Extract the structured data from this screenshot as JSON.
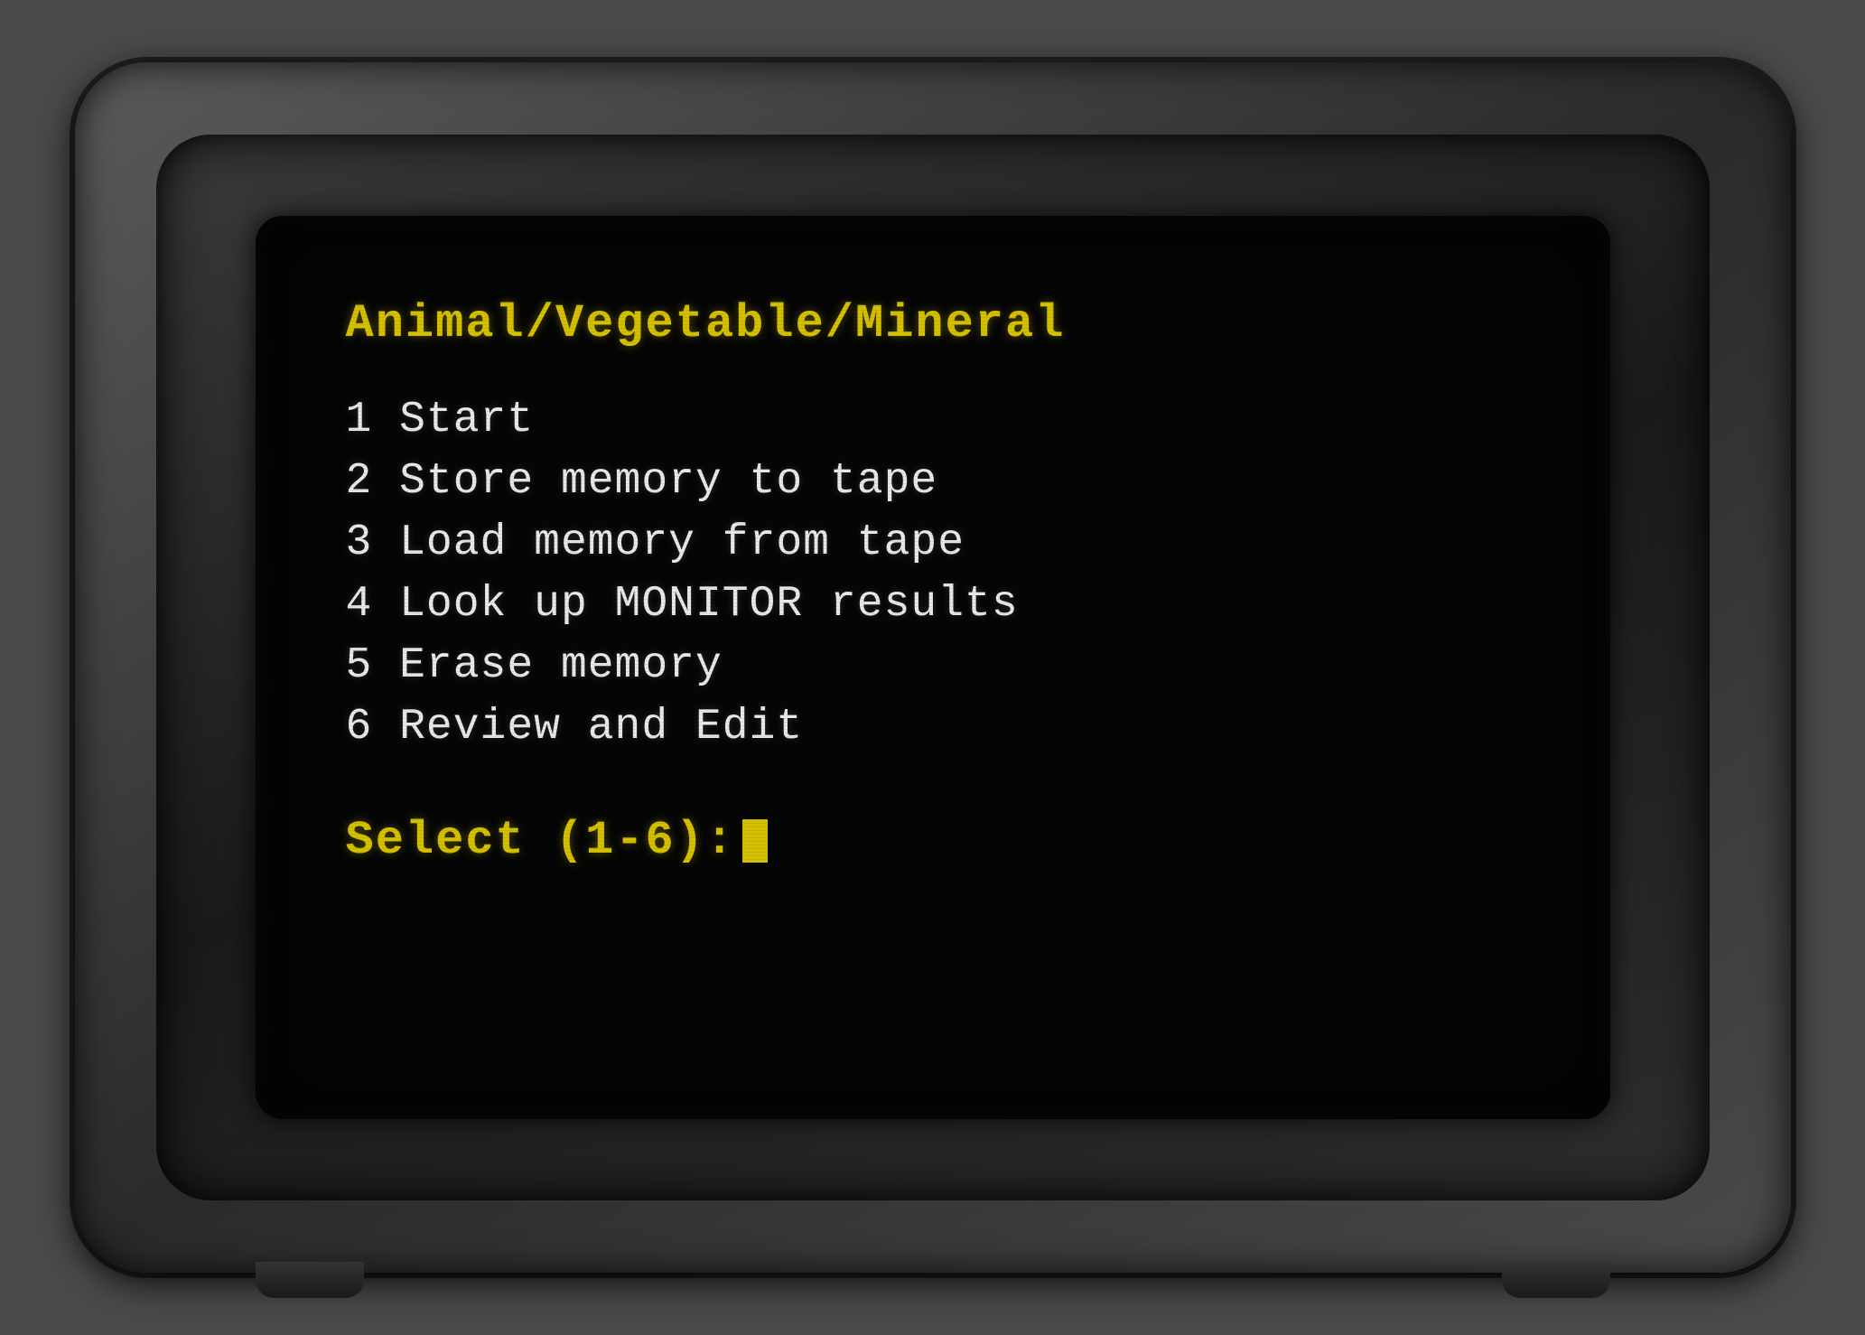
{
  "monitor": {
    "title": "Animal/Vegetable/Mineral",
    "menu_items": [
      {
        "number": "1",
        "label": "Start"
      },
      {
        "number": "2",
        "label": "Store memory to tape"
      },
      {
        "number": "3",
        "label": "Load memory from tape"
      },
      {
        "number": "4",
        "label": "Look up MONITOR results"
      },
      {
        "number": "5",
        "label": "Erase memory"
      },
      {
        "number": "6",
        "label": "Review and Edit"
      }
    ],
    "prompt": "Select (1-6): ",
    "cursor": "_",
    "colors": {
      "title": "#d4c000",
      "menu_text": "#e8e8e8",
      "prompt": "#d4c000",
      "screen_bg": "#050505"
    }
  }
}
